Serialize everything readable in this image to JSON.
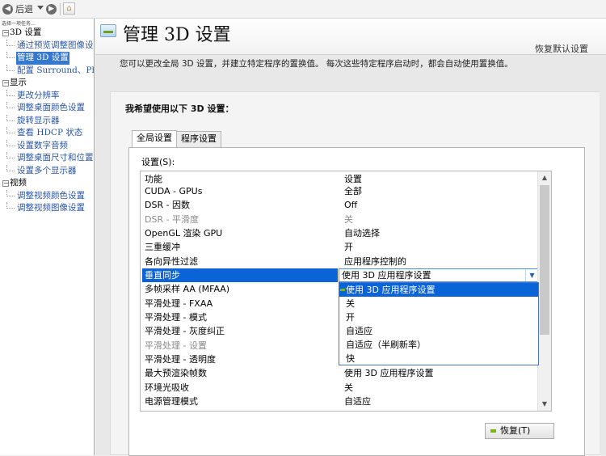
{
  "toolbar": {
    "back_label": "后退",
    "back_icon": "back-arrow-icon",
    "forward_icon": "forward-arrow-icon",
    "home_icon": "home-icon"
  },
  "sidebar": {
    "task_caption": "选择一项任务...",
    "tree": [
      {
        "type": "cat",
        "label": "3D 设置",
        "toggle": "−"
      },
      {
        "type": "leaf",
        "label": "通过预览调整图像设置",
        "selected": false
      },
      {
        "type": "leaf",
        "label": "管理 3D 设置",
        "selected": true
      },
      {
        "type": "leaf",
        "label": "配置 Surround、PhysX",
        "selected": false
      },
      {
        "type": "cat",
        "label": "显示",
        "toggle": "−"
      },
      {
        "type": "leaf",
        "label": "更改分辨率",
        "selected": false
      },
      {
        "type": "leaf",
        "label": "调整桌面颜色设置",
        "selected": false
      },
      {
        "type": "leaf",
        "label": "旋转显示器",
        "selected": false
      },
      {
        "type": "leaf",
        "label": "查看 HDCP 状态",
        "selected": false
      },
      {
        "type": "leaf",
        "label": "设置数字音频",
        "selected": false
      },
      {
        "type": "leaf",
        "label": "调整桌面尺寸和位置",
        "selected": false
      },
      {
        "type": "leaf",
        "label": "设置多个显示器",
        "selected": false
      },
      {
        "type": "cat",
        "label": "视频",
        "toggle": "−"
      },
      {
        "type": "leaf",
        "label": "调整视频颜色设置",
        "selected": false
      },
      {
        "type": "leaf",
        "label": "调整视频图像设置",
        "selected": false
      }
    ]
  },
  "header": {
    "title": "管理 3D 设置",
    "restore_defaults": "恢复默认设置",
    "description": "您可以更改全局 3D 设置，并建立特定程序的置换值。 每次这些特定程序启动时，都会自动使用置换值。"
  },
  "panel": {
    "title": "我希望使用以下 3D 设置：",
    "tabs": [
      {
        "label": "全局设置",
        "active": true
      },
      {
        "label": "程序设置",
        "active": false
      }
    ],
    "settings_label": "设置(S):",
    "columns": {
      "feature": "功能",
      "setting": "设置"
    },
    "rows": [
      {
        "feature": "CUDA - GPUs",
        "value": "全部",
        "disabled": false
      },
      {
        "feature": "DSR - 因数",
        "value": "Off",
        "disabled": false
      },
      {
        "feature": "DSR - 平滑度",
        "value": "关",
        "disabled": true
      },
      {
        "feature": "OpenGL 渲染 GPU",
        "value": "自动选择",
        "disabled": false
      },
      {
        "feature": "三重缓冲",
        "value": "开",
        "disabled": false
      },
      {
        "feature": "各向异性过滤",
        "value": "应用程序控制的",
        "disabled": false
      },
      {
        "feature": "垂直同步",
        "value": "",
        "disabled": false,
        "selected": true
      },
      {
        "feature": "多帧采样 AA (MFAA)",
        "value": "",
        "disabled": false
      },
      {
        "feature": "平滑处理 - FXAA",
        "value": "",
        "disabled": false
      },
      {
        "feature": "平滑处理 - 模式",
        "value": "",
        "disabled": false
      },
      {
        "feature": "平滑处理 - 灰度纠正",
        "value": "",
        "disabled": false
      },
      {
        "feature": "平滑处理 - 设置",
        "value": "",
        "disabled": true
      },
      {
        "feature": "平滑处理 - 透明度",
        "value": "",
        "disabled": false
      },
      {
        "feature": "最大预渲染帧数",
        "value": "使用 3D 应用程序设置",
        "disabled": false
      },
      {
        "feature": "环境光吸收",
        "value": "关",
        "disabled": false
      },
      {
        "feature": "电源管理模式",
        "value": "自适应",
        "disabled": false
      }
    ],
    "combo_value": "使用 3D 应用程序设置",
    "dropdown_options": [
      {
        "label": "使用 3D 应用程序设置",
        "selected": true
      },
      {
        "label": "关",
        "selected": false
      },
      {
        "label": "开",
        "selected": false
      },
      {
        "label": "自适应",
        "selected": false
      },
      {
        "label": "自适应（半刷新率）",
        "selected": false
      },
      {
        "label": "快",
        "selected": false
      }
    ],
    "restore_button": "恢复(T)"
  },
  "colors": {
    "accent_selection": "#0a64d8",
    "tree_link": "#2a55a4",
    "nvidia_green": "#76b900"
  }
}
